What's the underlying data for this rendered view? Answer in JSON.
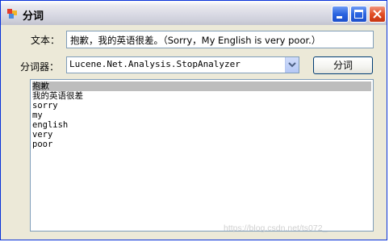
{
  "window": {
    "title": "分词"
  },
  "form": {
    "text_label": "文本：",
    "text_value": "抱歉，我的英语很差。（Sorry，My English is very poor.）",
    "analyzer_label": "分词器：",
    "analyzer_value": "Lucene.Net.Analysis.StopAnalyzer",
    "button_label": "分词"
  },
  "results": {
    "items": [
      "抱歉",
      "我的英语很差",
      "sorry",
      "my",
      "english",
      "very",
      "poor"
    ],
    "selected_index": 0
  },
  "watermark": "https://blog.csdn.net/ts072_",
  "colors": {
    "selection": "#bdbdbd",
    "border": "#7f9db9",
    "face": "#ece9d8"
  }
}
